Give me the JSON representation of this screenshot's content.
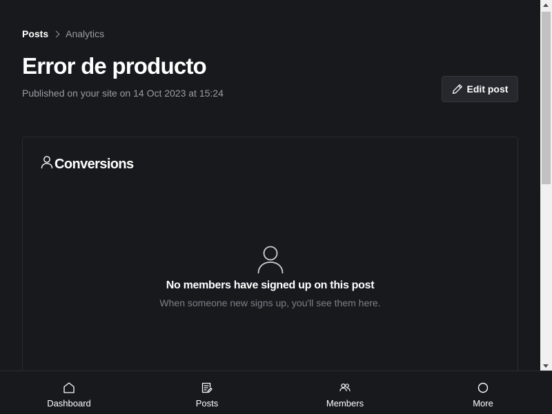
{
  "breadcrumb": {
    "root": "Posts",
    "current": "Analytics"
  },
  "post": {
    "title": "Error de producto",
    "published": "Published on your site on 14 Oct 2023 at 15:24"
  },
  "header": {
    "edit_label": "Edit post"
  },
  "conversions": {
    "title": "Conversions",
    "empty_title": "No members have signed up on this post",
    "empty_subtitle": "When someone new signs up, you'll see them here."
  },
  "bottom_nav": {
    "items": [
      {
        "label": "Dashboard",
        "icon": "home-icon"
      },
      {
        "label": "Posts",
        "icon": "posts-icon"
      },
      {
        "label": "Members",
        "icon": "members-icon"
      },
      {
        "label": "More",
        "icon": "circle-icon"
      }
    ]
  },
  "colors": {
    "background": "#18191d",
    "text": "#ffffff",
    "muted": "#9a9ca3",
    "border": "#2a2c31",
    "button_bg": "#26282d"
  }
}
